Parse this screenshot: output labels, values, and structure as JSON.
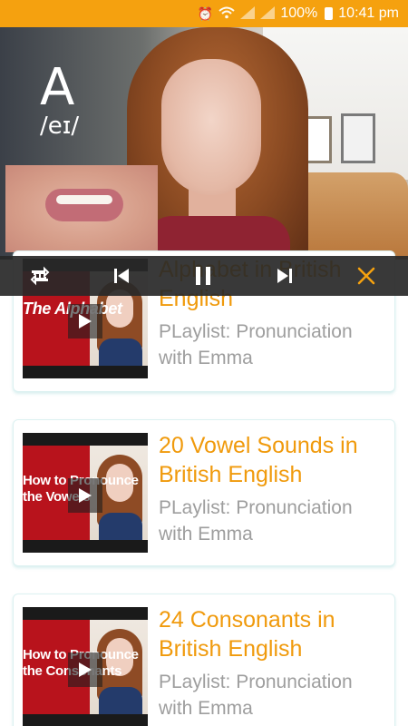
{
  "status_bar": {
    "battery_percent": "100%",
    "time": "10:41 pm",
    "icons": [
      "alarm-icon",
      "wifi-icon",
      "signal-icon",
      "signal-icon",
      "battery-icon"
    ]
  },
  "video": {
    "letter": "A",
    "ipa": "/eɪ/"
  },
  "controls": {
    "icons": [
      "repeat-icon",
      "previous-icon",
      "pause-icon",
      "next-icon",
      "close-icon"
    ],
    "accent_color": "#f5a10f"
  },
  "playlist": [
    {
      "title": "Alphabet in British English",
      "subtitle": "PLaylist: Pronunciation with Emma",
      "thumb_text": "The Alphabet"
    },
    {
      "title": "20 Vowel Sounds in British English",
      "subtitle": "PLaylist: Pronunciation with Emma",
      "thumb_text": "How to Pronounce the Vowels"
    },
    {
      "title": "24 Consonants in British English",
      "subtitle": "PLaylist: Pronunciation with Emma",
      "thumb_text": "How to Pronounce the Consonants"
    }
  ],
  "colors": {
    "status_bar": "#f5a10f",
    "title": "#f09a0c",
    "subtitle": "#9e9e9e"
  }
}
